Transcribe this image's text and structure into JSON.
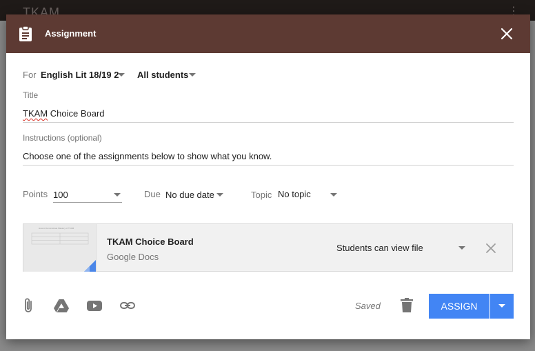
{
  "background": {
    "title": "TKAM"
  },
  "header": {
    "title": "Assignment",
    "bg_color": "#5d3a33"
  },
  "for_row": {
    "label": "For",
    "class_value": "English Lit 18/19 2",
    "students_value": "All students"
  },
  "title_field": {
    "label": "Title",
    "value_misspelled": "TKAM",
    "value_rest": " Choice Board"
  },
  "instructions_field": {
    "label": "Instructions (optional)",
    "value": "Choose one of the assignments below to show what you know."
  },
  "options": {
    "points_label": "Points",
    "points_value": "100",
    "due_label": "Due",
    "due_value": "No due date",
    "topic_label": "Topic",
    "topic_value": "No topic"
  },
  "attachment": {
    "title": "TKAM Choice Board",
    "source": "Google Docs",
    "permission": "Students can view file",
    "thumb_heading": "How to Demonstrate Mastery of TKAM"
  },
  "footer": {
    "saved_text": "Saved",
    "assign_label": "ASSIGN",
    "accent_color": "#4285f4"
  },
  "icons": [
    "clipboard-icon",
    "close-icon",
    "paperclip-icon",
    "google-drive-icon",
    "youtube-icon",
    "link-icon",
    "trash-icon",
    "chevron-down-icon"
  ]
}
